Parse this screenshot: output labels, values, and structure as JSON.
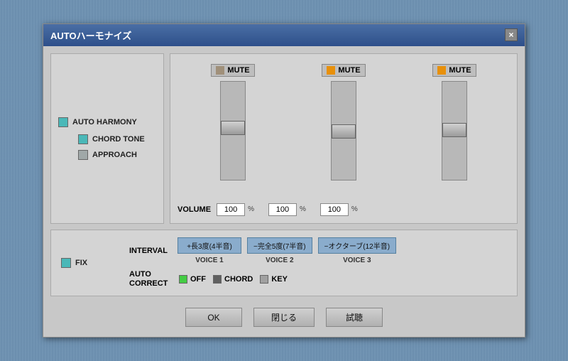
{
  "dialog": {
    "title": "AUTOハーモナイズ",
    "close_label": "×"
  },
  "left_panel": {
    "auto_harmony_label": "AUTO HARMONY",
    "chord_tone_label": "CHORD TONE",
    "approach_label": "APPROACH"
  },
  "sliders": {
    "mute_label": "MUTE",
    "volume_label": "VOLUME",
    "pct_label": "%",
    "col1": {
      "value": "100",
      "mute_type": "gray"
    },
    "col2": {
      "value": "100",
      "mute_type": "orange"
    },
    "col3": {
      "value": "100",
      "mute_type": "orange"
    }
  },
  "bottom": {
    "fix_label": "FIX",
    "interval_label": "INTERVAL",
    "voice1_interval": "+長3度(4半音)",
    "voice2_interval": "−完全5度(7半音)",
    "voice3_interval": "−オクターブ(12半音)",
    "voice1_label": "VOICE 1",
    "voice2_label": "VOICE 2",
    "voice3_label": "VOICE 3",
    "autocorrect_label": "AUTO\nCORRECT",
    "off_label": "OFF",
    "chord_label": "CHORD",
    "key_label": "KEY"
  },
  "footer": {
    "ok_label": "OK",
    "close_label": "閉じる",
    "trial_label": "試聴"
  }
}
